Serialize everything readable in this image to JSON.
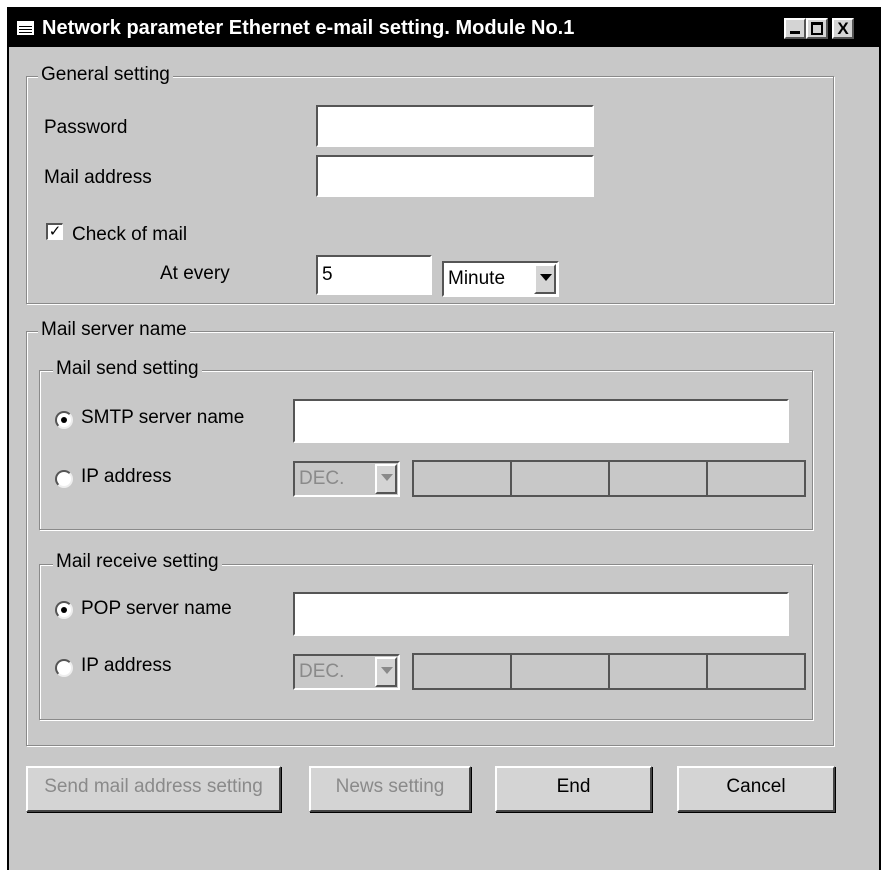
{
  "window": {
    "title": "Network parameter Ethernet e-mail setting. Module No.1",
    "close_glyph": "X"
  },
  "general": {
    "title": "General setting",
    "password_label": "Password",
    "password_value": "",
    "mail_address_label": "Mail address",
    "mail_address_value": "",
    "check_of_mail_label": "Check of mail",
    "check_of_mail_checked": true,
    "check_glyph": "✓",
    "at_every_label": "At every",
    "at_every_value": "5",
    "unit_value": "Minute"
  },
  "server": {
    "title": "Mail server name",
    "send": {
      "title": "Mail send setting",
      "smtp_label": "SMTP server name",
      "smtp_value": "",
      "ip_label": "IP address",
      "ip_format": "DEC.",
      "selected": "smtp"
    },
    "receive": {
      "title": "Mail receive setting",
      "pop_label": "POP server name",
      "pop_value": "",
      "ip_label": "IP address",
      "ip_format": "DEC.",
      "selected": "pop"
    }
  },
  "buttons": {
    "send_mail_address": "Send mail address setting",
    "news": "News setting",
    "end": "End",
    "cancel": "Cancel"
  },
  "icons": [
    "window-icon",
    "minimize-icon",
    "maximize-icon",
    "close-icon",
    "checkbox-checked-icon",
    "radio-selected-icon",
    "radio-unselected-icon",
    "dropdown-arrow-icon"
  ]
}
